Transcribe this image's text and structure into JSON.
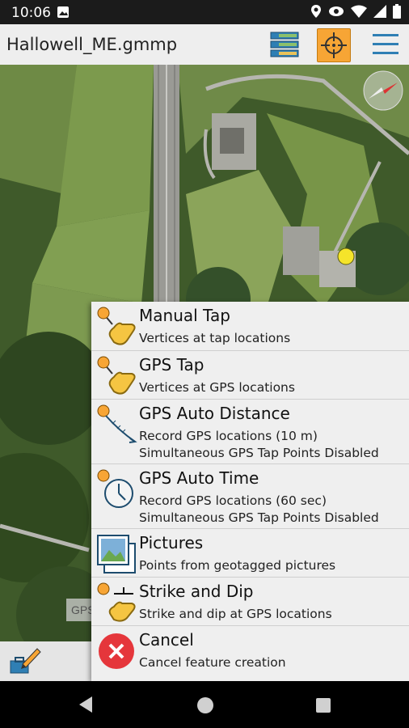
{
  "status_bar": {
    "time": "10:06",
    "icons": [
      "image-icon",
      "location-icon",
      "eye-icon",
      "wifi-icon",
      "signal-icon",
      "battery-icon"
    ]
  },
  "toolbar": {
    "title": "Hallowell_ME.gmmp",
    "icons": [
      "layers-icon",
      "gps-target-icon",
      "hamburger-menu-icon"
    ],
    "accent": "#f7a535"
  },
  "map": {
    "gps_label": "GPS"
  },
  "menu": {
    "items": [
      {
        "title": "Manual Tap",
        "sub1": "Vertices at tap locations",
        "sub2": "",
        "icon": "manual-tap-icon"
      },
      {
        "title": "GPS Tap",
        "sub1": "Vertices at GPS locations",
        "sub2": "",
        "icon": "gps-tap-icon"
      },
      {
        "title": "GPS Auto Distance",
        "sub1": "Record GPS locations (10 m)",
        "sub2": "Simultaneous GPS Tap Points Disabled",
        "icon": "gps-auto-distance-icon"
      },
      {
        "title": "GPS Auto Time",
        "sub1": "Record GPS locations (60 sec)",
        "sub2": "Simultaneous GPS Tap Points Disabled",
        "icon": "gps-auto-time-icon"
      },
      {
        "title": "Pictures",
        "sub1": "Points from geotagged pictures",
        "sub2": "",
        "icon": "pictures-icon"
      },
      {
        "title": "Strike and Dip",
        "sub1": "Strike and dip at GPS locations",
        "sub2": "",
        "icon": "strike-dip-icon"
      },
      {
        "title": "Cancel",
        "sub1": "Cancel feature creation",
        "sub2": "",
        "icon": "cancel-icon"
      }
    ]
  },
  "nav": {
    "icons": [
      "back-icon",
      "home-icon",
      "recents-icon"
    ]
  }
}
